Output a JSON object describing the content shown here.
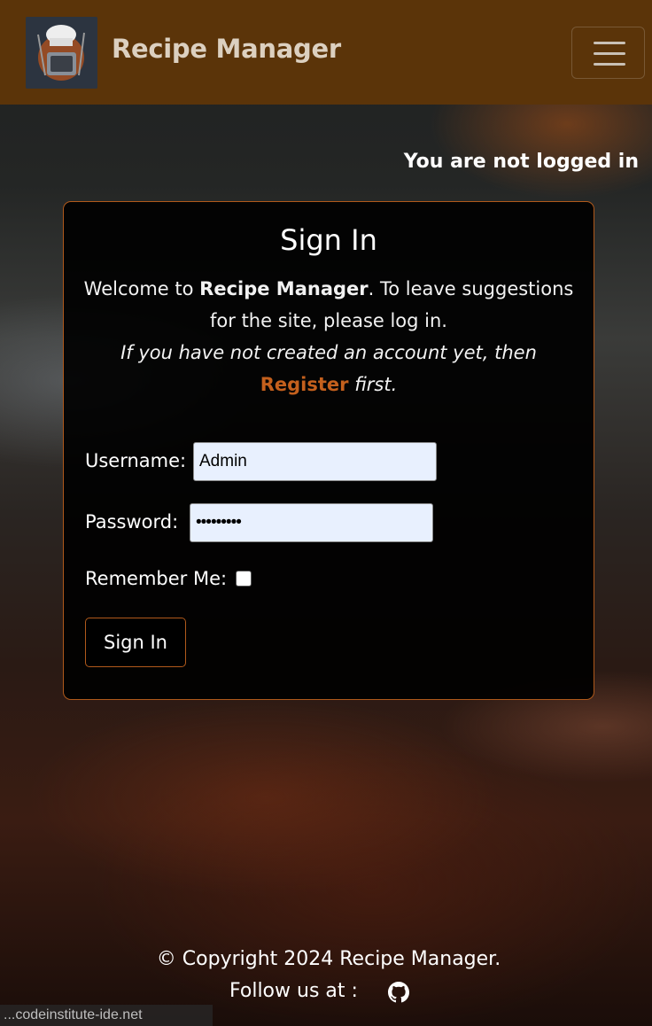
{
  "navbar": {
    "brand": "Recipe Manager",
    "logo_icon": "chef-hat-logo-icon",
    "toggler_icon": "hamburger-menu-icon"
  },
  "status": "You are not logged in",
  "card": {
    "title": "Sign In",
    "intro_prefix": "Welcome to ",
    "intro_brand": "Recipe Manager",
    "intro_suffix": ". To leave suggestions for the site, please log in.",
    "intro_italic_1": "If you have not created an account yet, then",
    "register_link": "Register",
    "intro_italic_2": " first."
  },
  "form": {
    "username_label": "Username:",
    "username_value": "Admin",
    "password_label": "Password:",
    "password_value": "•••••••••",
    "remember_label": "Remember Me:",
    "remember_checked": false,
    "submit_label": "Sign In"
  },
  "footer": {
    "copyright": "© Copyright 2024 Recipe Manager.",
    "follow": "Follow us at :",
    "github_icon": "github-icon"
  },
  "browser_status": "...codeinstitute-ide.net",
  "colors": {
    "navbar": "#5b3409",
    "accent": "#c4601d",
    "card_border": "#b0591b"
  }
}
